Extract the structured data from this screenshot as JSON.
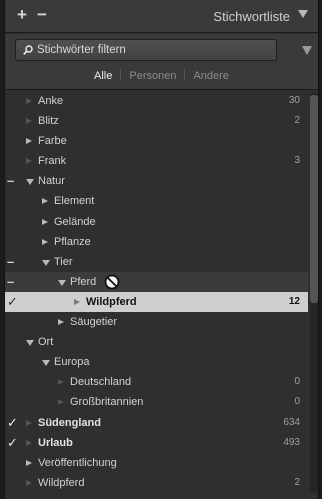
{
  "header": {
    "title": "Stichwortliste",
    "add_label": "+",
    "remove_label": "−"
  },
  "filter": {
    "placeholder": "Stichwörter filtern",
    "tabs": [
      {
        "label": "Alle",
        "active": true
      },
      {
        "label": "Personen",
        "active": false
      },
      {
        "label": "Andere",
        "active": false
      }
    ]
  },
  "keywords": [
    {
      "label": "Anke",
      "count": "30",
      "level": 0,
      "expander": "empty",
      "marker": ""
    },
    {
      "label": "Blitz",
      "count": "2",
      "level": 0,
      "expander": "empty",
      "marker": ""
    },
    {
      "label": "Farbe",
      "count": "",
      "level": 0,
      "expander": "right",
      "marker": ""
    },
    {
      "label": "Frank",
      "count": "3",
      "level": 0,
      "expander": "empty",
      "marker": ""
    },
    {
      "label": "Natur",
      "count": "",
      "level": 0,
      "expander": "down",
      "marker": "minus"
    },
    {
      "label": "Element",
      "count": "",
      "level": 1,
      "expander": "right",
      "marker": ""
    },
    {
      "label": "Gelände",
      "count": "",
      "level": 1,
      "expander": "right",
      "marker": ""
    },
    {
      "label": "Pflanze",
      "count": "",
      "level": 1,
      "expander": "right",
      "marker": ""
    },
    {
      "label": "Tier",
      "count": "",
      "level": 1,
      "expander": "down",
      "marker": "minus"
    },
    {
      "label": "Pferd",
      "count": "",
      "level": 2,
      "expander": "down",
      "marker": "minus",
      "blocked": true,
      "hover": true
    },
    {
      "label": "Wildpferd",
      "count": "12",
      "level": 3,
      "expander": "empty",
      "marker": "check",
      "selected": true,
      "bold": true
    },
    {
      "label": "Säugetier",
      "count": "",
      "level": 2,
      "expander": "right",
      "marker": ""
    },
    {
      "label": "Ort",
      "count": "",
      "level": 0,
      "expander": "down",
      "marker": ""
    },
    {
      "label": "Europa",
      "count": "",
      "level": 1,
      "expander": "down",
      "marker": ""
    },
    {
      "label": "Deutschland",
      "count": "0",
      "level": 2,
      "expander": "empty",
      "marker": ""
    },
    {
      "label": "Großbritannien",
      "count": "0",
      "level": 2,
      "expander": "empty",
      "marker": ""
    },
    {
      "label": "Südengland",
      "count": "634",
      "level": 0,
      "expander": "empty",
      "marker": "check",
      "bold": true
    },
    {
      "label": "Urlaub",
      "count": "493",
      "level": 0,
      "expander": "empty",
      "marker": "check",
      "bold": true
    },
    {
      "label": "Veröffentlichung",
      "count": "",
      "level": 0,
      "expander": "right",
      "marker": ""
    },
    {
      "label": "Wildpferd",
      "count": "2",
      "level": 0,
      "expander": "empty",
      "marker": ""
    }
  ],
  "icons": {
    "search": "search-icon",
    "blocked": "no-entry-cursor-icon",
    "check": "checkmark-icon",
    "menu": "triangle-down-icon"
  }
}
